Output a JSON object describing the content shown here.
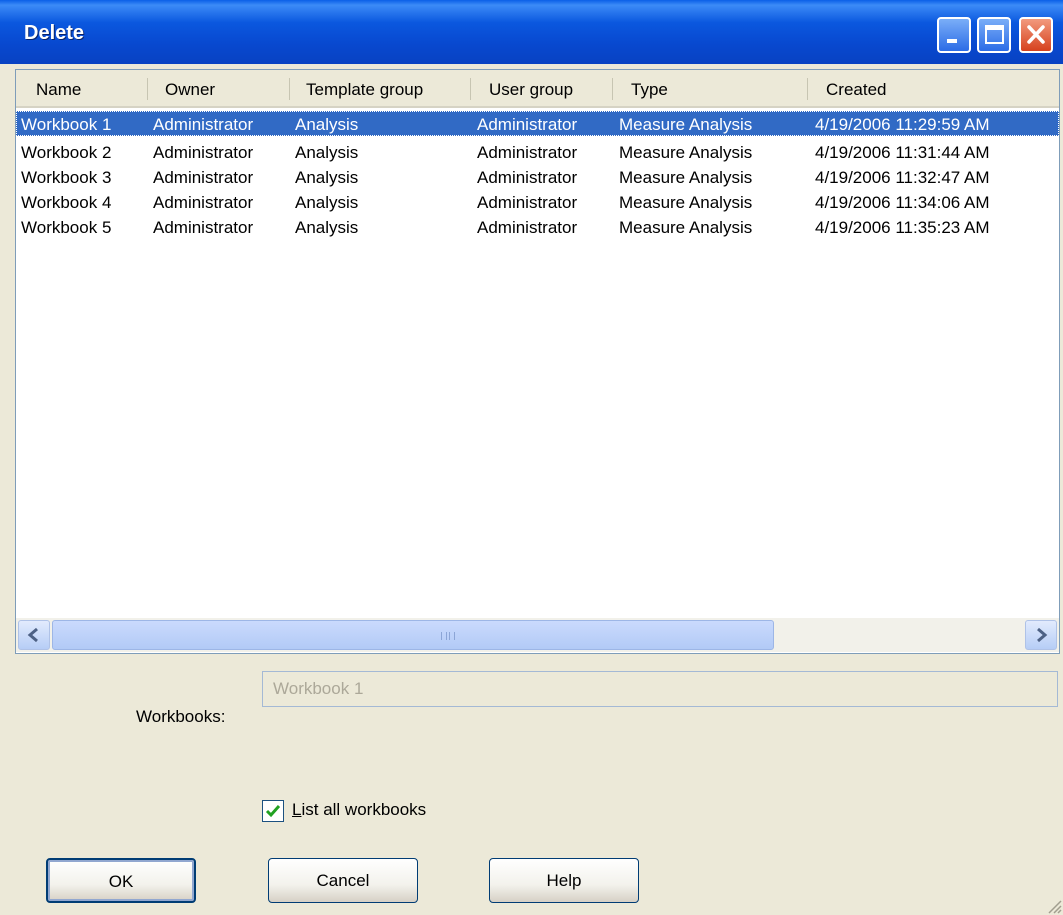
{
  "window": {
    "title": "Delete"
  },
  "list": {
    "columns": [
      "Name",
      "Owner",
      "Template group",
      "User group",
      "Type",
      "Created"
    ],
    "rows": [
      [
        "Workbook 1",
        "Administrator",
        "Analysis",
        "Administrator",
        "Measure Analysis",
        "4/19/2006 11:29:59 AM"
      ],
      [
        "Workbook 2",
        "Administrator",
        "Analysis",
        "Administrator",
        "Measure Analysis",
        "4/19/2006 11:31:44 AM"
      ],
      [
        "Workbook 3",
        "Administrator",
        "Analysis",
        "Administrator",
        "Measure Analysis",
        "4/19/2006 11:32:47 AM"
      ],
      [
        "Workbook 4",
        "Administrator",
        "Analysis",
        "Administrator",
        "Measure Analysis",
        "4/19/2006 11:34:06 AM"
      ],
      [
        "Workbook 5",
        "Administrator",
        "Analysis",
        "Administrator",
        "Measure Analysis",
        "4/19/2006 11:35:23 AM"
      ]
    ],
    "selected_row": 1
  },
  "form": {
    "workbooks_label": "Workbooks:",
    "workbooks_value": "Workbook 1",
    "list_all_label": "List all workbooks",
    "list_all_checked": true
  },
  "buttons": {
    "ok": "OK",
    "cancel": "Cancel",
    "help": "Help"
  },
  "icons": {
    "minimize": "minimize-icon",
    "maximize": "maximize-icon",
    "close": "close-icon",
    "scroll_left": "chevron-left-icon",
    "scroll_right": "chevron-right-icon",
    "check": "checkmark-icon"
  },
  "colors": {
    "title_bar": "#0B58DF",
    "selection": "#316AC5",
    "face": "#ECE9D8"
  }
}
